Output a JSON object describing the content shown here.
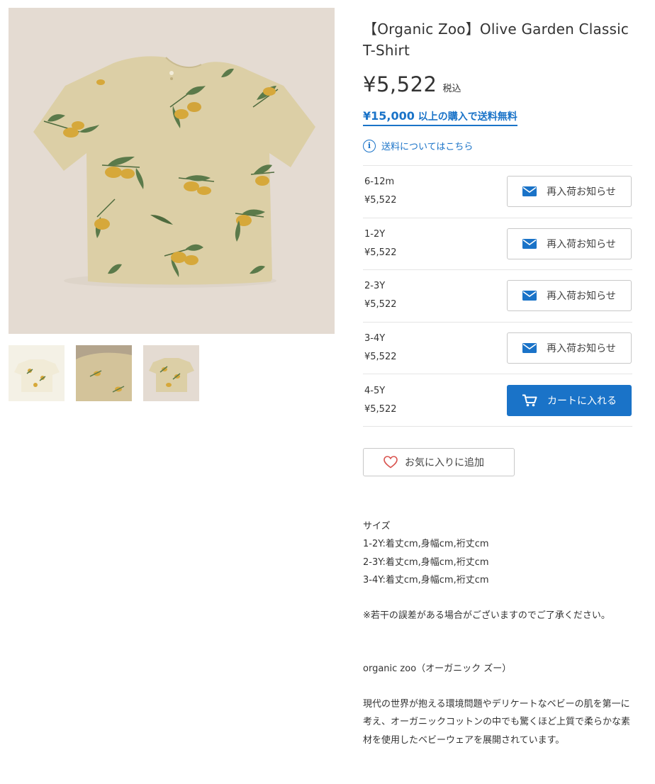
{
  "product": {
    "title": "【Organic Zoo】Olive Garden Classic T-Shirt",
    "price": "¥5,522",
    "tax_label": "税込",
    "free_shipping_amount": "¥15,000",
    "free_shipping_text": "以上の購入で送料無料",
    "shipping_info_link": "送料についてはこちら"
  },
  "variants": [
    {
      "size": "6-12m",
      "price": "¥5,522",
      "action": "再入荷お知らせ",
      "type": "notify"
    },
    {
      "size": "1-2Y",
      "price": "¥5,522",
      "action": "再入荷お知らせ",
      "type": "notify"
    },
    {
      "size": "2-3Y",
      "price": "¥5,522",
      "action": "再入荷お知らせ",
      "type": "notify"
    },
    {
      "size": "3-4Y",
      "price": "¥5,522",
      "action": "再入荷お知らせ",
      "type": "notify"
    },
    {
      "size": "4-5Y",
      "price": "¥5,522",
      "action": "カートに入れる",
      "type": "cart"
    }
  ],
  "favorite_label": "お気に入りに追加",
  "description": {
    "size_heading": "サイズ",
    "size_lines": [
      "1-2Y:着丈cm,身幅cm,裄丈cm",
      "2-3Y:着丈cm,身幅cm,裄丈cm",
      "3-4Y:着丈cm,身幅cm,裄丈cm"
    ],
    "note": "※若干の誤差がある場合がございますのでご了承ください。",
    "brand": "organic zoo（オーガニック ズー）",
    "brand_text": "現代の世界が抱える環境問題やデリケートなベビーの肌を第一に考え、オーガニックコットンの中でも驚くほど上質で柔らかな素材を使用したベビーウェアを展開されています。"
  },
  "colors": {
    "accent": "#1a73c8",
    "shirt": "#ddd0a8",
    "olive": "#d6a83a",
    "leaf": "#5b7a4a",
    "bg": "#e4dbd2"
  },
  "icons": {
    "info": "info-icon",
    "mail": "mail-icon",
    "cart": "cart-icon",
    "heart": "heart-icon"
  }
}
